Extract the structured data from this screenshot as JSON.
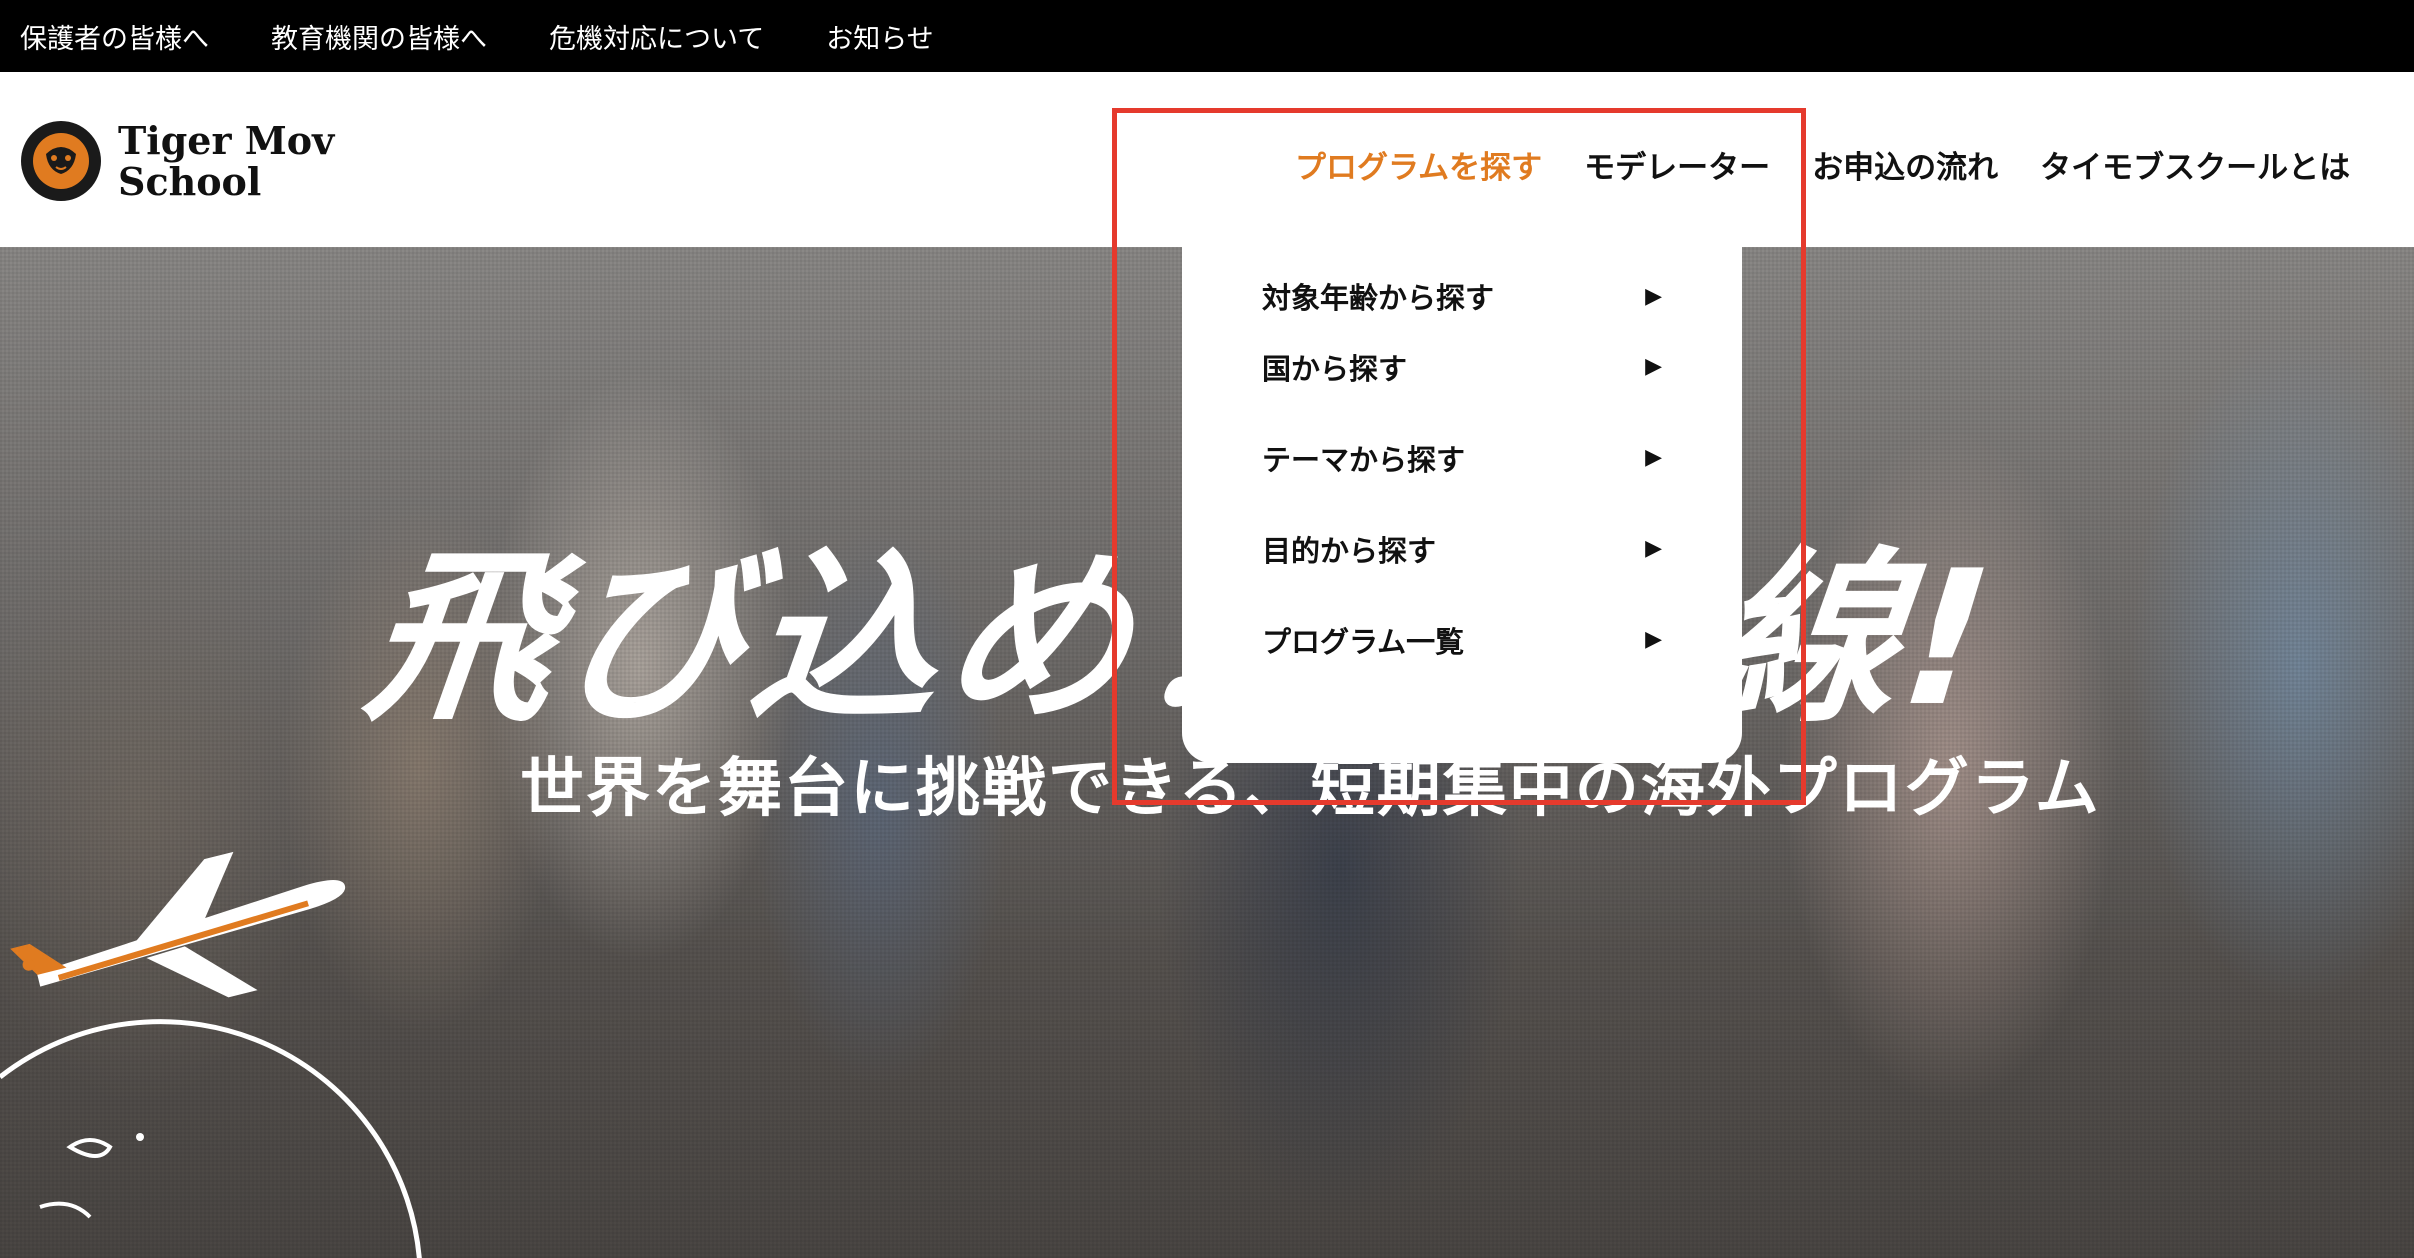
{
  "topbar": {
    "links": [
      "保護者の皆様へ",
      "教育機関の皆様へ",
      "危機対応について",
      "お知らせ"
    ]
  },
  "brand": {
    "name_line1": "Tiger Mov",
    "name_line2": "School",
    "accent_color": "#e07b20"
  },
  "nav": {
    "items": [
      {
        "label": "プログラムを探す",
        "active": true
      },
      {
        "label": "モデレーター"
      },
      {
        "label": "お申込の流れ"
      },
      {
        "label": "タイモブスクールとは"
      }
    ]
  },
  "dropdown": {
    "items": [
      {
        "label": "対象年齢から探す",
        "icon": "triangle-right-icon"
      },
      {
        "label": "国から探す",
        "icon": "triangle-right-icon"
      },
      {
        "label": "テーマから探す",
        "icon": "triangle-right-icon"
      },
      {
        "label": "目的から探す",
        "icon": "triangle-right-icon"
      },
      {
        "label": "プログラム一覧",
        "icon": "triangle-right-icon"
      }
    ]
  },
  "hero": {
    "headline": "飛び込め！最前線!",
    "subline": "世界を舞台に挑戦できる、短期集中の海外プログラム"
  },
  "annotation": {
    "highlight_color": "#e53a2d"
  }
}
